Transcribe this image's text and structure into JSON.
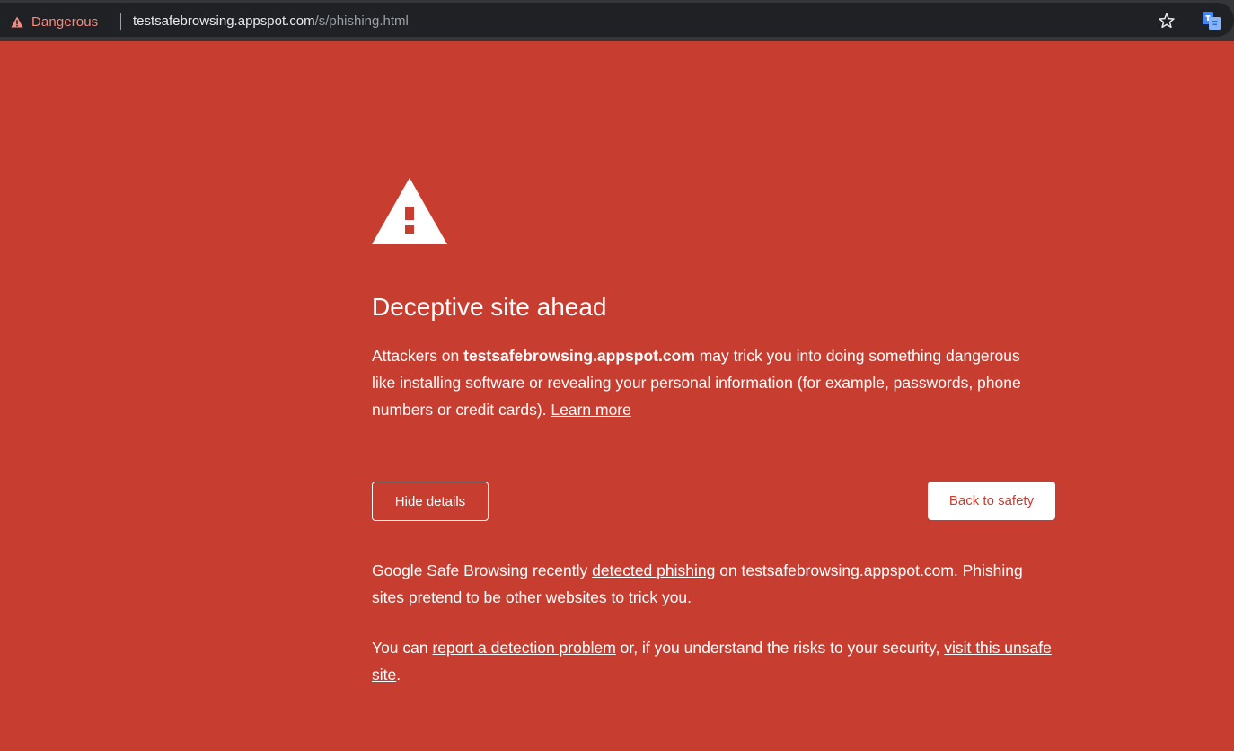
{
  "omnibox": {
    "security_label": "Dangerous",
    "url_host": "testsafebrowsing.appspot.com",
    "url_path": "/s/phishing.html",
    "icons": [
      "warning-icon",
      "star-icon",
      "translate-icon"
    ]
  },
  "interstitial": {
    "heading": "Deceptive site ahead",
    "main_message": {
      "prefix": "Attackers on ",
      "site": "testsafebrowsing.appspot.com",
      "suffix": " may trick you into doing something dangerous like installing software or revealing your personal information (for example, passwords, phone numbers or credit cards). ",
      "learn_more": "Learn more"
    },
    "hide_details_label": "Hide details",
    "back_to_safety_label": "Back to safety",
    "details_1": {
      "prefix": "Google Safe Browsing recently ",
      "link": "detected phishing",
      "suffix": " on testsafebrowsing.appspot.com. Phishing sites pretend to be other websites to trick you."
    },
    "details_2": {
      "prefix": "You can ",
      "report_link": "report a detection problem",
      "middle": " or, if you understand the risks to your security, ",
      "visit_link": "visit this unsafe site",
      "suffix": "."
    }
  },
  "colors": {
    "page_background": "#c73d30",
    "omnibox_background": "#202124",
    "danger_text": "#f28b82",
    "url_host": "#e8eaed",
    "url_path": "#9aa0a6"
  }
}
